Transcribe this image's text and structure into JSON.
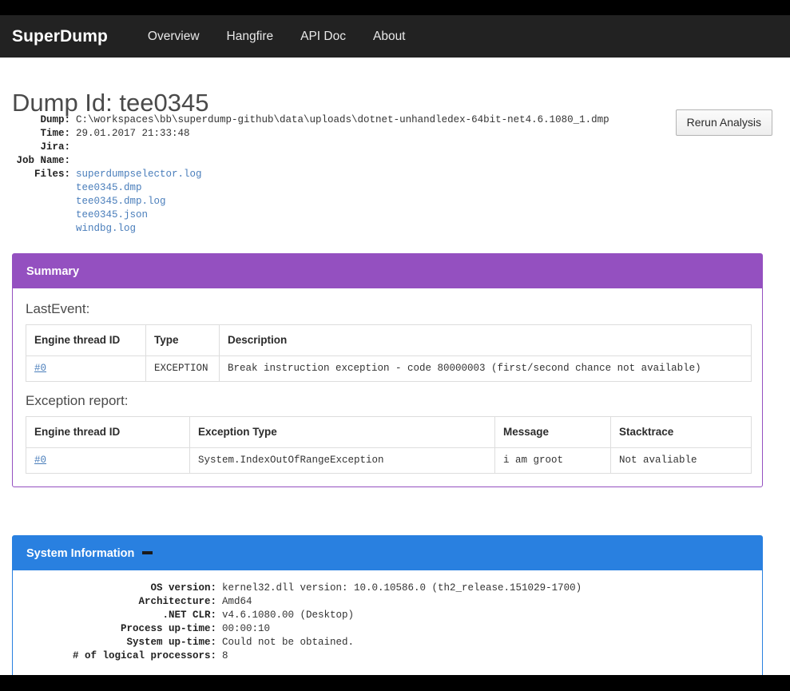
{
  "navbar": {
    "brand": "SuperDump",
    "links": [
      {
        "label": "Overview"
      },
      {
        "label": "Hangfire"
      },
      {
        "label": "API Doc"
      },
      {
        "label": "About"
      }
    ]
  },
  "page": {
    "title": "Dump Id: tee0345"
  },
  "toolbar": {
    "rerun_label": "Rerun Analysis"
  },
  "meta": {
    "rows": [
      {
        "label": "Dump:",
        "value": "C:\\workspaces\\bb\\superdump-github\\data\\uploads\\dotnet-unhandledex-64bit-net4.6.1080_1.dmp"
      },
      {
        "label": "Time:",
        "value": "29.01.2017 21:33:48"
      },
      {
        "label": "Jira:",
        "value": ""
      },
      {
        "label": "Job Name:",
        "value": ""
      }
    ],
    "files_label": "Files:",
    "files": [
      {
        "name": "superdumpselector.log"
      },
      {
        "name": "tee0345.dmp"
      },
      {
        "name": "tee0345.dmp.log"
      },
      {
        "name": "tee0345.json"
      },
      {
        "name": "windbg.log"
      }
    ]
  },
  "summary_panel": {
    "heading": "Summary",
    "lastevent": {
      "title": "LastEvent:",
      "columns": [
        "Engine thread ID",
        "Type",
        "Description"
      ],
      "rows": [
        {
          "thread": "#0",
          "type": "EXCEPTION",
          "description": "Break instruction exception - code 80000003 (first/second chance not available)"
        }
      ]
    },
    "exception_report": {
      "title": "Exception report:",
      "columns": [
        "Engine thread ID",
        "Exception Type",
        "Message",
        "Stacktrace"
      ],
      "rows": [
        {
          "thread": "#0",
          "exception_type": "System.IndexOutOfRangeException",
          "message": "i am groot",
          "stacktrace": "Not avaliable"
        }
      ]
    }
  },
  "system_panel": {
    "heading": "System Information",
    "collapse_icon": "minus-icon",
    "rows": [
      {
        "label": "OS version:",
        "value": "kernel32.dll version: 10.0.10586.0 (th2_release.151029-1700)"
      },
      {
        "label": "Architecture:",
        "value": "Amd64"
      },
      {
        "label": ".NET CLR:",
        "value": "v4.6.1080.00 (Desktop)"
      },
      {
        "label": "Process up-time:",
        "value": "00:00:10"
      },
      {
        "label": "System up-time:",
        "value": "Could not be obtained."
      },
      {
        "label": "# of logical processors:",
        "value": "8"
      }
    ]
  },
  "colors": {
    "navbar_bg": "#222222",
    "summary_accent": "#9450c0",
    "system_accent": "#2980e0",
    "link": "#4a7ebb",
    "border": "#dddddd"
  }
}
